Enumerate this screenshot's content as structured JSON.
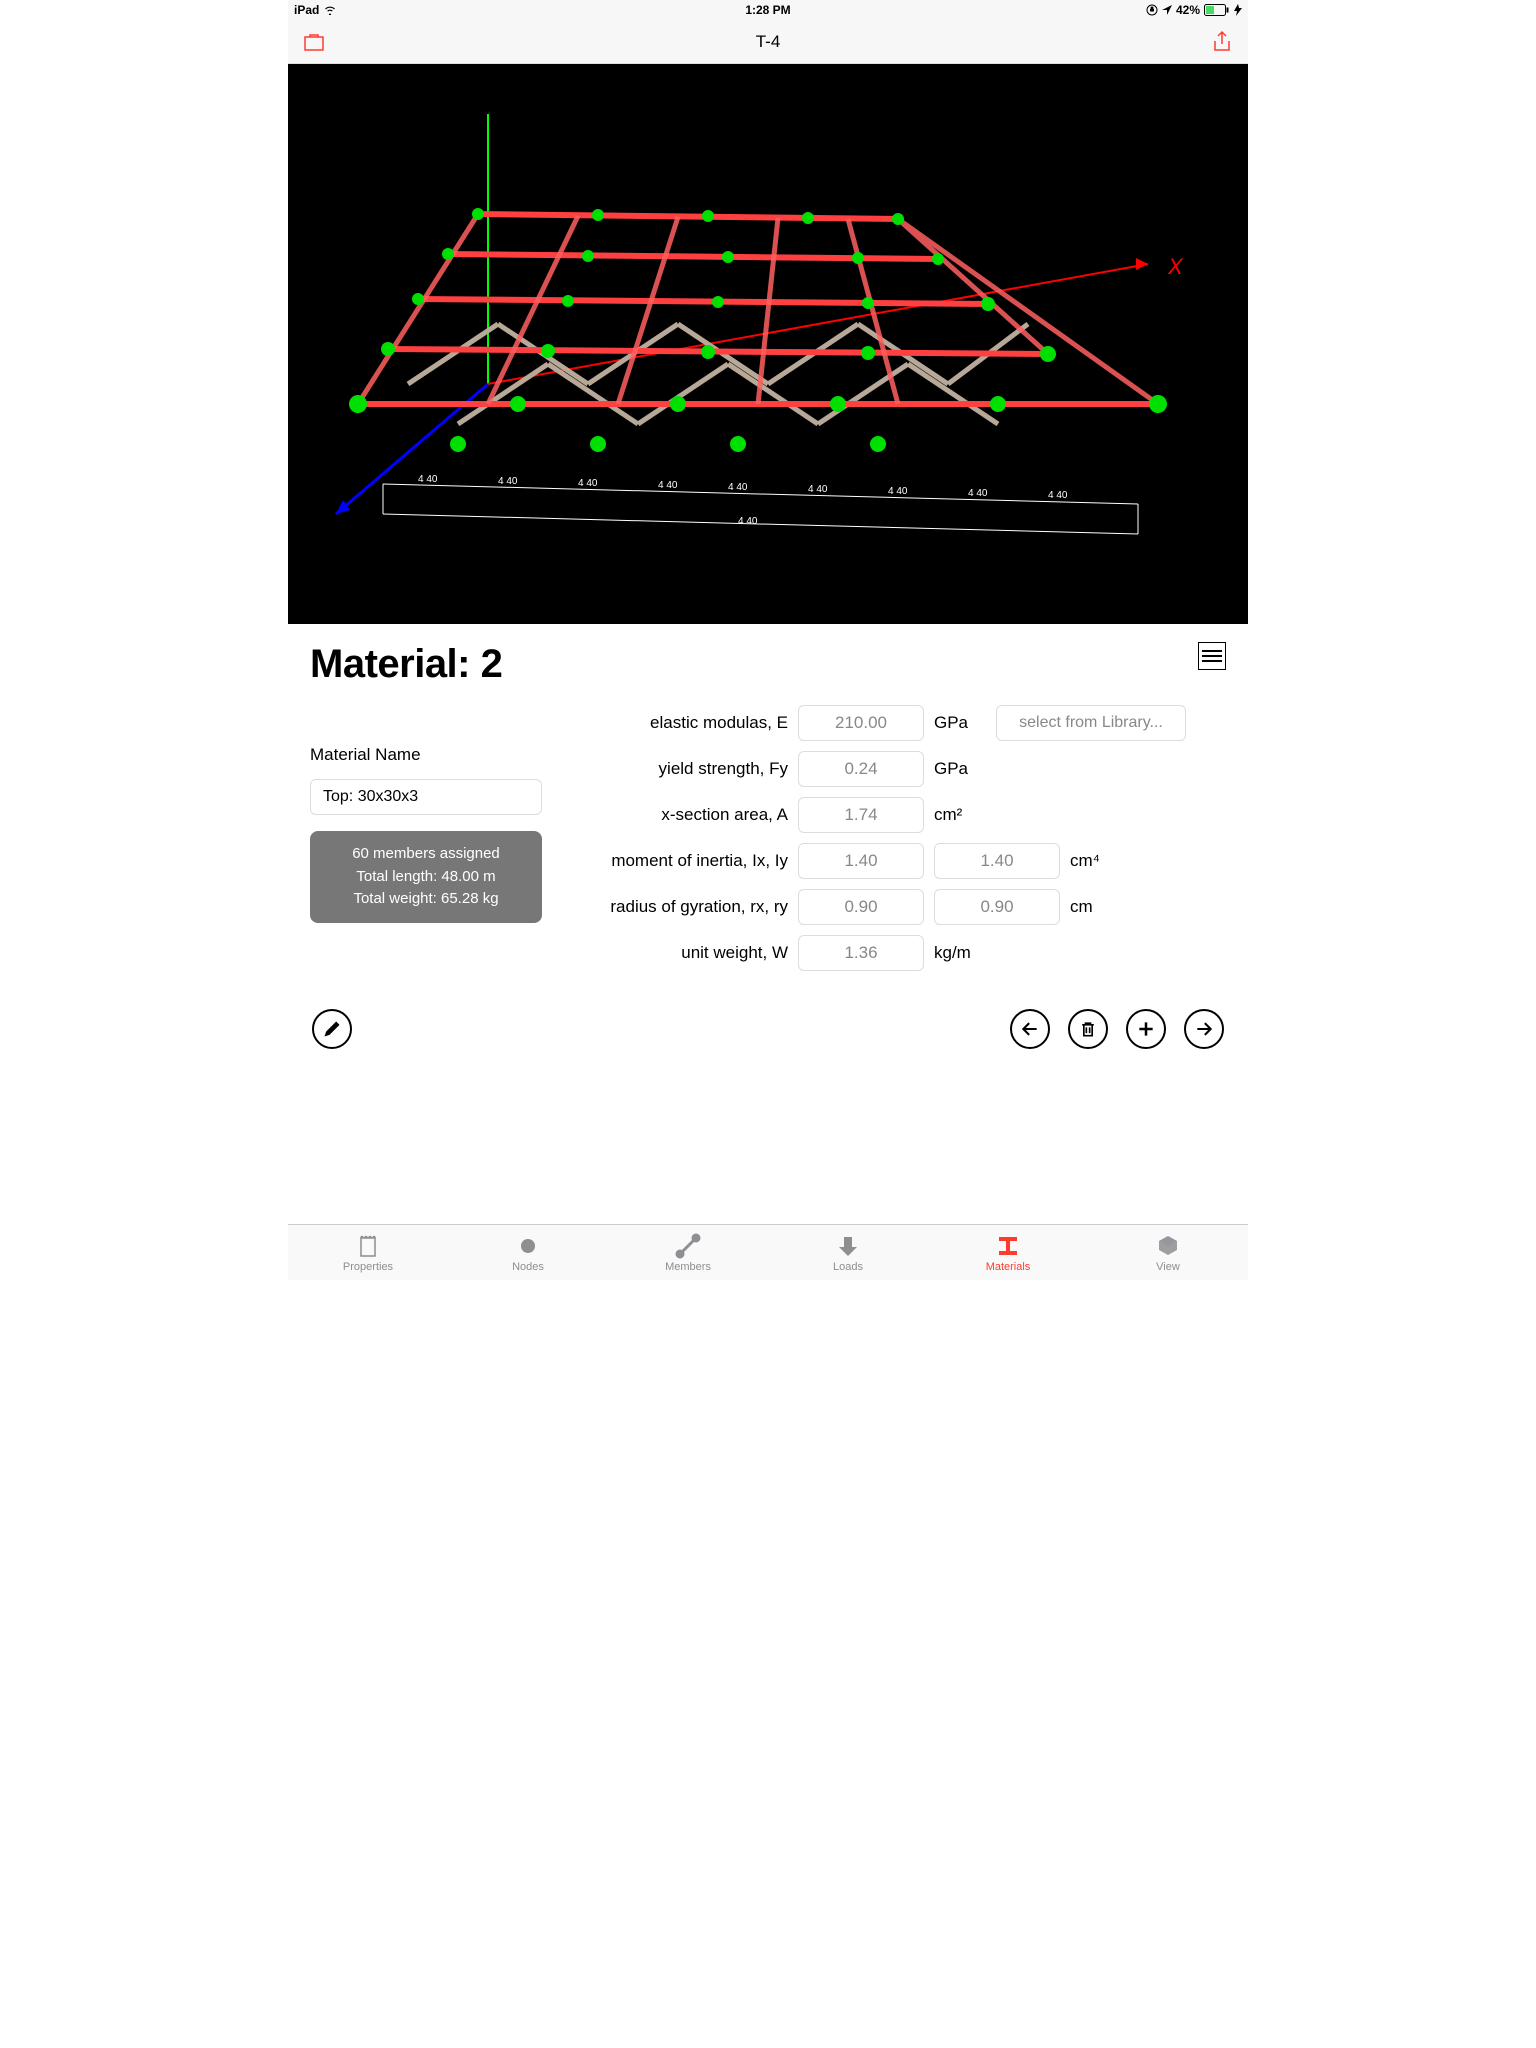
{
  "status": {
    "device": "iPad",
    "time": "1:28 PM",
    "battery_pct": "42%"
  },
  "nav": {
    "title": "T-4"
  },
  "viewport": {
    "x_axis_label": "X"
  },
  "panel": {
    "title": "Material: 2",
    "material_name_label": "Material Name",
    "material_name_value": "Top: 30x30x3",
    "info": {
      "line1": "60 members assigned",
      "line2": "Total length: 48.00 m",
      "line3": "Total weight: 65.28 kg"
    },
    "props": {
      "elastic_label": "elastic modulas, E",
      "elastic_value": "210.00",
      "elastic_unit": "GPa",
      "library_btn": "select from Library...",
      "yield_label": "yield strength, Fy",
      "yield_value": "0.24",
      "yield_unit": "GPa",
      "area_label": "x-section area, A",
      "area_value": "1.74",
      "area_unit": "cm²",
      "inertia_label": "moment of inertia, Ix, Iy",
      "inertia_ix": "1.40",
      "inertia_iy": "1.40",
      "inertia_unit": "cm⁴",
      "gyration_label": "radius of gyration, rx, ry",
      "gyration_rx": "0.90",
      "gyration_ry": "0.90",
      "gyration_unit": "cm",
      "weight_label": "unit weight, W",
      "weight_value": "1.36",
      "weight_unit": "kg/m"
    }
  },
  "tabs": {
    "properties": "Properties",
    "nodes": "Nodes",
    "members": "Members",
    "loads": "Loads",
    "materials": "Materials",
    "view": "View"
  }
}
